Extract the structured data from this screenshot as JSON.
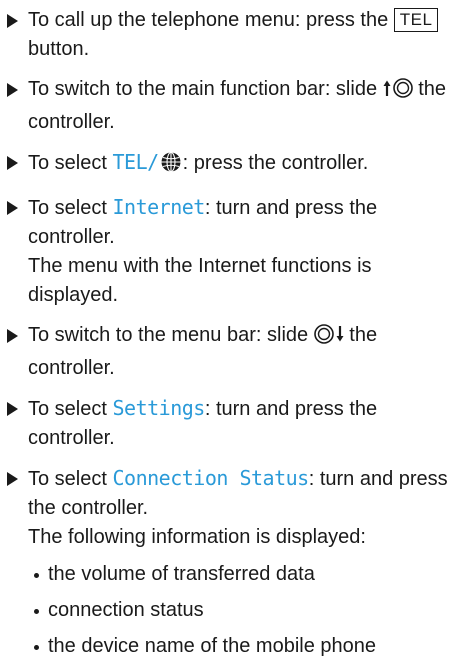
{
  "steps": [
    {
      "before": "To call up the telephone menu: press the",
      "key": "TEL",
      "after": "button."
    },
    {
      "text": "To switch to the main function bar: slide",
      "before_icon": "slide-up-arrow",
      "icon": "controller-icon",
      "after": "the controller."
    },
    {
      "before": "To select",
      "keyword": "TEL/",
      "icon": "globe-icon",
      "after": ": press the controller."
    },
    {
      "before": "To select",
      "keyword": "Internet",
      "after": ": turn and press the controller.",
      "result": "The menu with the Internet functions is displayed."
    },
    {
      "before": "To switch to the menu bar: slide",
      "icon": "controller-icon",
      "after_icon": "slide-down-arrow",
      "after": "the controller."
    },
    {
      "before": "To select",
      "keyword": "Settings",
      "after": ": turn and press the controller."
    },
    {
      "before": "To select",
      "keyword": "Connection Status",
      "after": ": turn and press the controller.",
      "result": "The following information is displayed:",
      "bullets": [
        "the volume of transferred data",
        "connection status",
        "the device name of the mobile phone"
      ]
    }
  ],
  "colors": {
    "text": "#1a1a1a",
    "keyword": "#2a9ad8"
  }
}
